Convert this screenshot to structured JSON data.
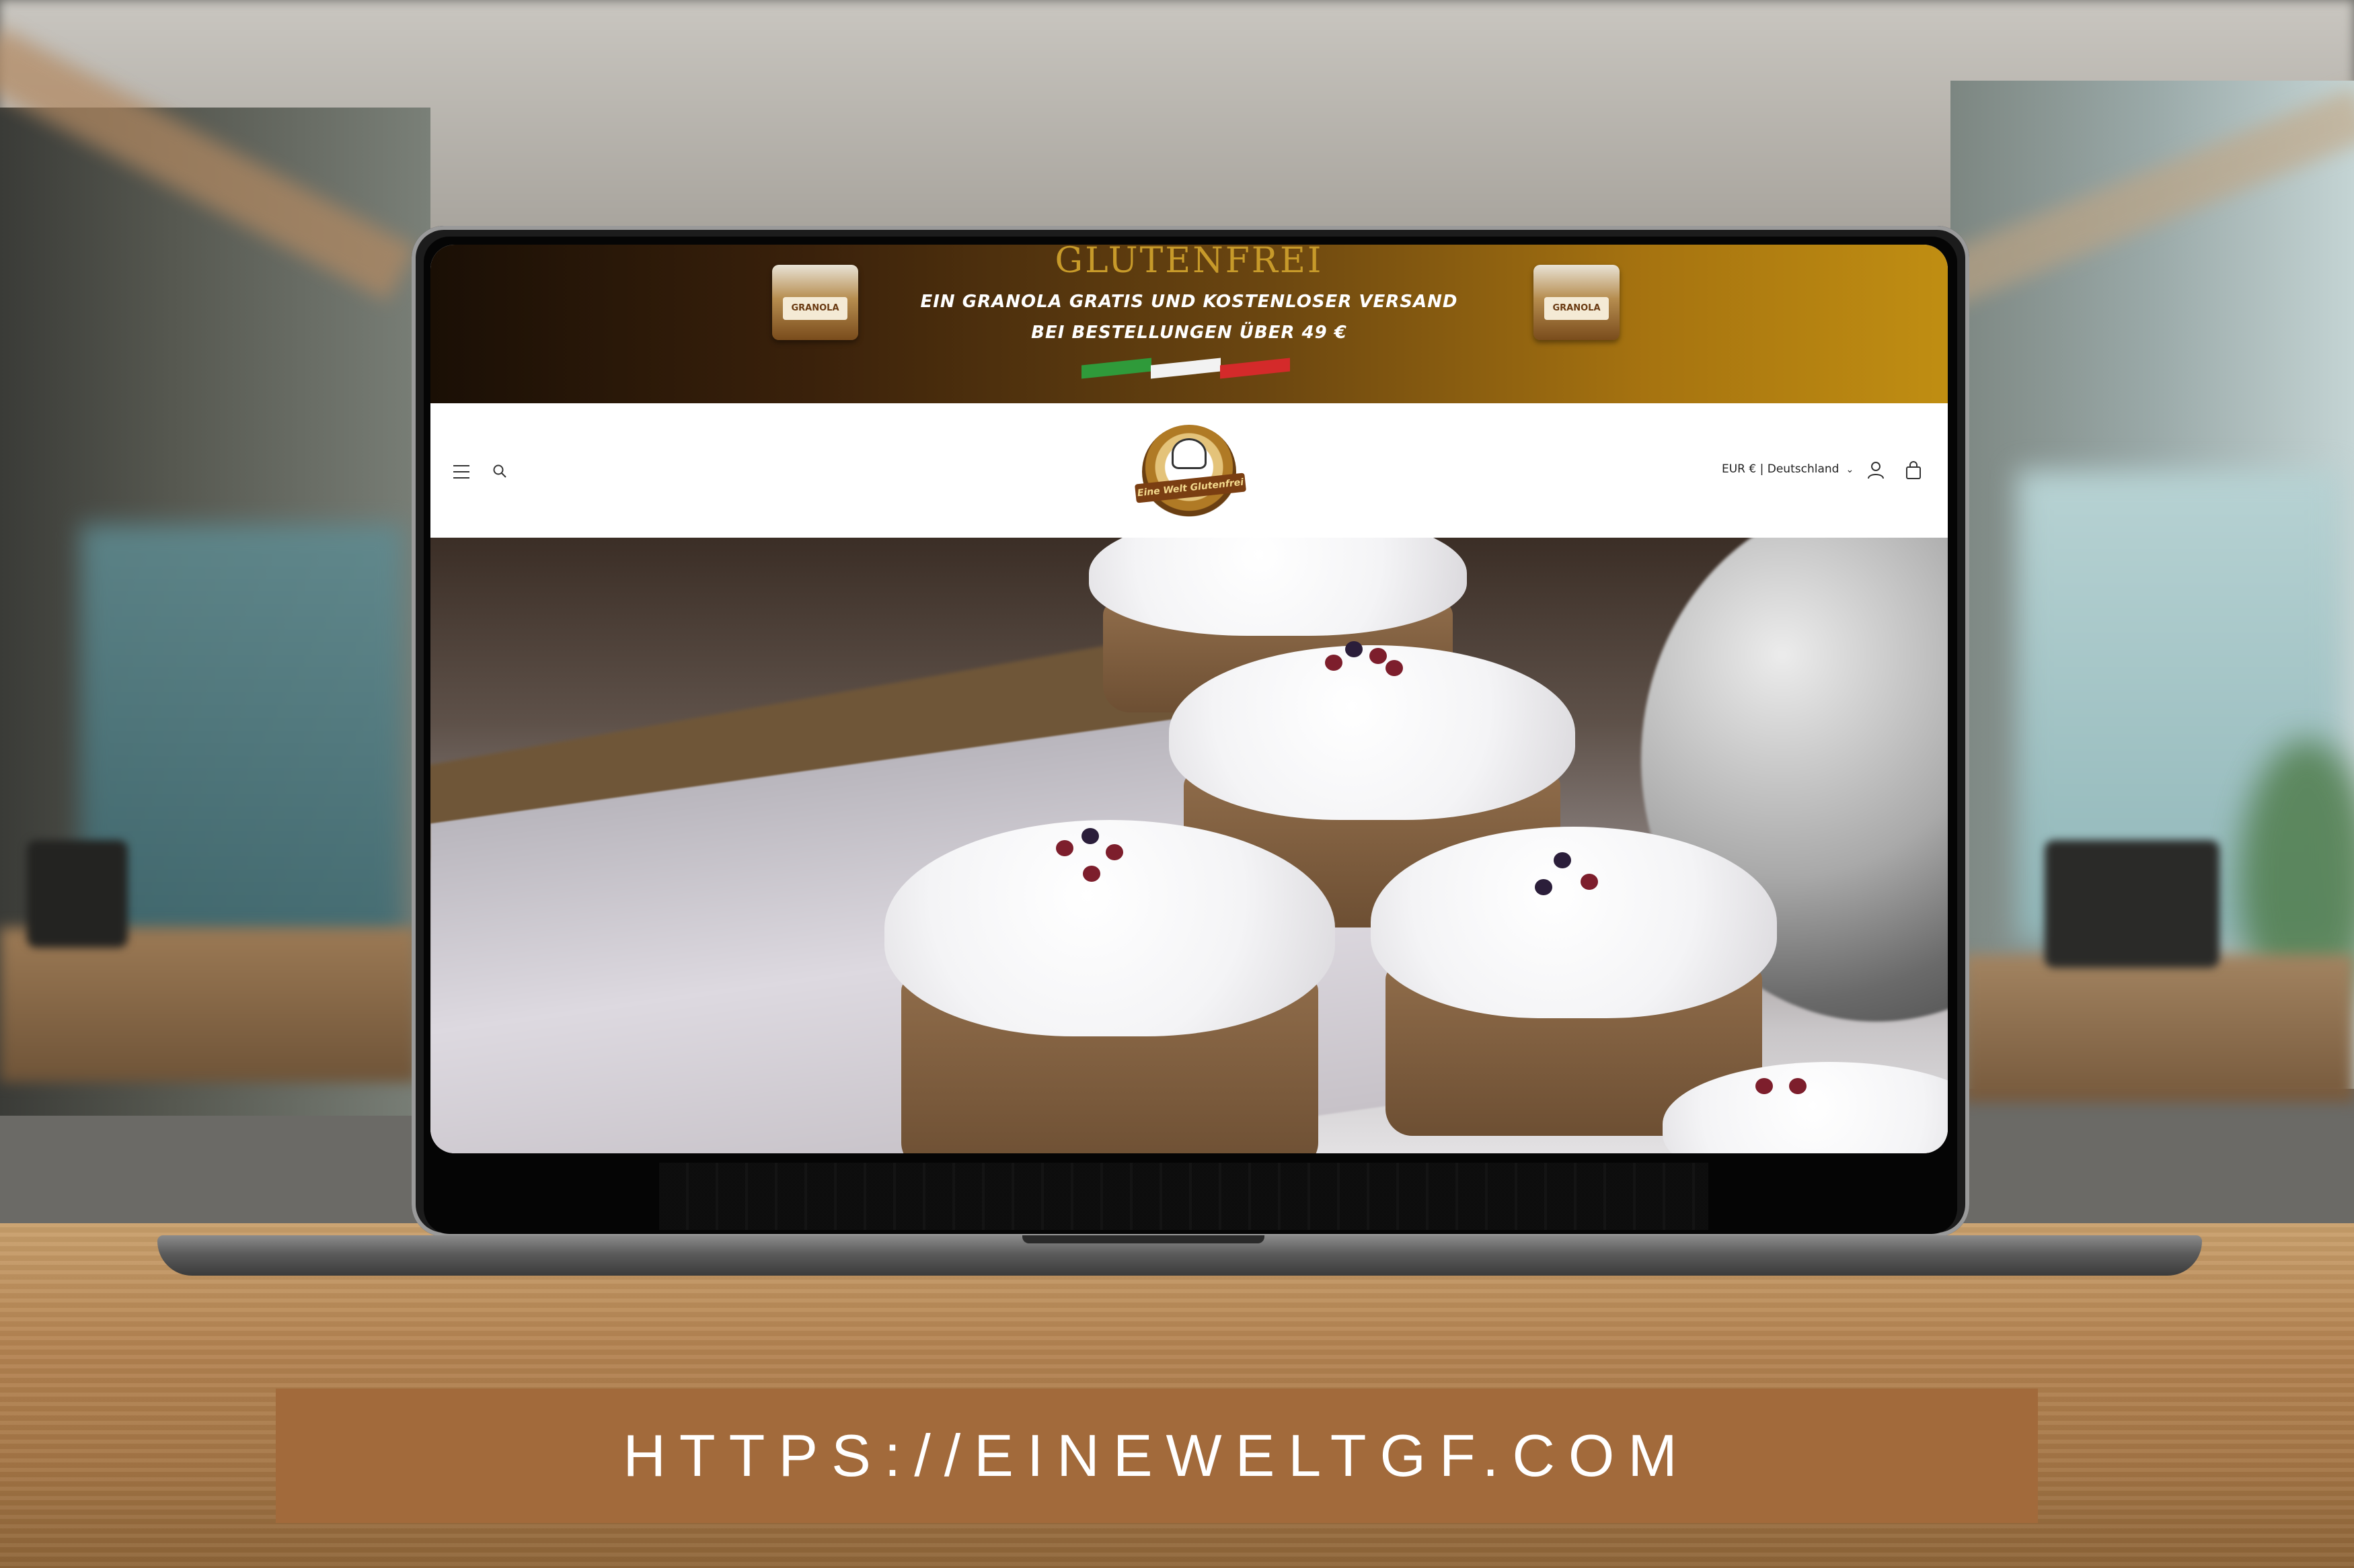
{
  "promo": {
    "title": "GLUTENFREI",
    "line1": "EIN GRANOLA GRATIS UND KOSTENLOSER VERSAND",
    "line2": "BEI BESTELLUNGEN ÜBER 49 €",
    "jar_label": "GRANOLA"
  },
  "header": {
    "logo_text": "Eine Welt Glutenfrei",
    "currency_selector": "EUR € | Deutschland",
    "icons": [
      "menu-icon",
      "search-icon",
      "account-icon",
      "cart-icon",
      "chevron-down-icon"
    ]
  },
  "banner": {
    "url": "HTTPS://EINEWELTGF.COM"
  },
  "colors": {
    "banner_bg": "#a26a3b",
    "promo_gradient_start": "#1a0f05",
    "promo_gradient_end": "#c08e12"
  }
}
